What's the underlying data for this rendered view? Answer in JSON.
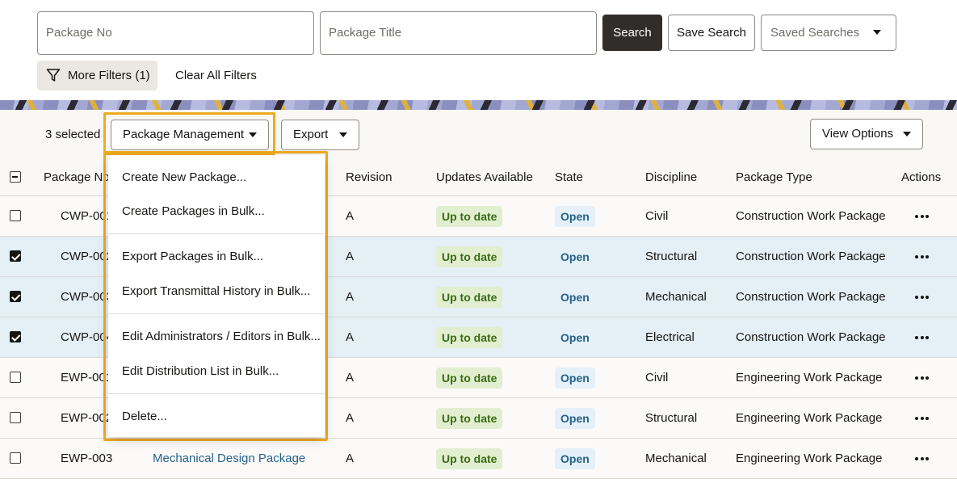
{
  "search": {
    "package_no_placeholder": "Package No",
    "package_title_placeholder": "Package Title",
    "search_button": "Search",
    "save_search_button": "Save Search",
    "saved_searches_label": "Saved Searches",
    "more_filters_label": "More Filters (1)",
    "clear_filters_label": "Clear All Filters"
  },
  "toolbar": {
    "selected_count": "3 selected",
    "package_management_label": "Package Management",
    "export_label": "Export",
    "view_options_label": "View Options"
  },
  "menu": {
    "items": [
      "Create New Package...",
      "Create Packages in Bulk...",
      "Export Packages in Bulk...",
      "Export Transmittal History in Bulk...",
      "Edit Administrators / Editors in Bulk...",
      "Edit Distribution List in Bulk...",
      "Delete..."
    ]
  },
  "table": {
    "headers": {
      "package_no": "Package No",
      "revision": "Revision",
      "updates": "Updates Available",
      "state": "State",
      "discipline": "Discipline",
      "package_type": "Package Type",
      "actions": "Actions"
    },
    "rows": [
      {
        "package_no": "CWP-001",
        "title": "",
        "revision": "A",
        "updates": "Up to date",
        "state": "Open",
        "discipline": "Civil",
        "type": "Construction Work Package",
        "selected": false
      },
      {
        "package_no": "CWP-002",
        "title": "",
        "revision": "A",
        "updates": "Up to date",
        "state": "Open",
        "discipline": "Structural",
        "type": "Construction Work Package",
        "selected": true
      },
      {
        "package_no": "CWP-003",
        "title": "",
        "revision": "A",
        "updates": "Up to date",
        "state": "Open",
        "discipline": "Mechanical",
        "type": "Construction Work Package",
        "selected": true
      },
      {
        "package_no": "CWP-004",
        "title": "",
        "revision": "A",
        "updates": "Up to date",
        "state": "Open",
        "discipline": "Electrical",
        "type": "Construction Work Package",
        "selected": true
      },
      {
        "package_no": "EWP-001",
        "title": "",
        "revision": "A",
        "updates": "Up to date",
        "state": "Open",
        "discipline": "Civil",
        "type": "Engineering Work Package",
        "selected": false
      },
      {
        "package_no": "EWP-002",
        "title": "",
        "revision": "A",
        "updates": "Up to date",
        "state": "Open",
        "discipline": "Structural",
        "type": "Engineering Work Package",
        "selected": false
      },
      {
        "package_no": "EWP-003",
        "title": "Mechanical Design Package",
        "revision": "A",
        "updates": "Up to date",
        "state": "Open",
        "discipline": "Mechanical",
        "type": "Engineering Work Package",
        "selected": false
      }
    ]
  },
  "colors": {
    "highlight": "#f0ab1f",
    "selected_row": "#e4eff6",
    "badge_green_bg": "#e1efd0",
    "badge_blue_bg": "#e5f0f8",
    "link": "#24628a"
  }
}
